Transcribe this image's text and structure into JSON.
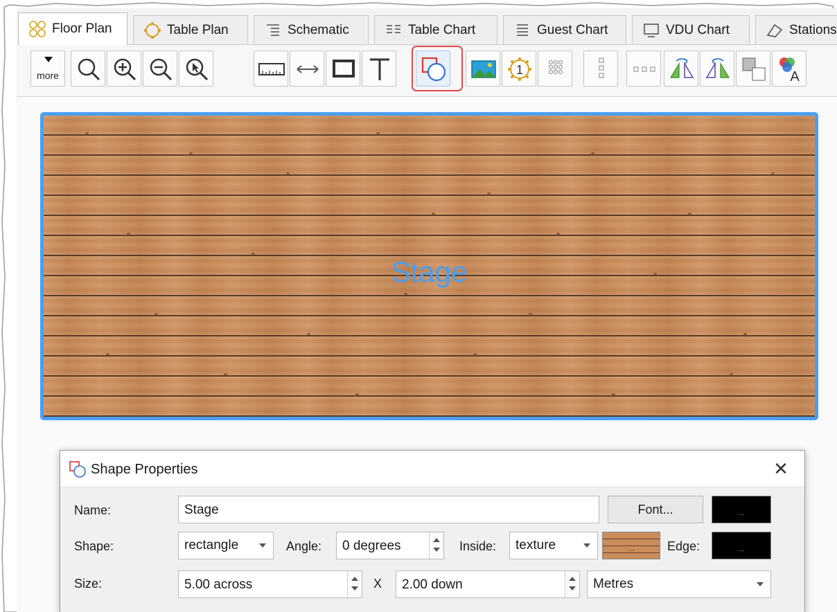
{
  "tabs": [
    {
      "label": "Floor Plan",
      "icon": "floor-plan-icon",
      "active": true
    },
    {
      "label": "Table Plan",
      "icon": "table-plan-icon",
      "active": false
    },
    {
      "label": "Schematic",
      "icon": "schematic-icon",
      "active": false
    },
    {
      "label": "Table Chart",
      "icon": "table-chart-icon",
      "active": false
    },
    {
      "label": "Guest Chart",
      "icon": "guest-chart-icon",
      "active": false
    },
    {
      "label": "VDU Chart",
      "icon": "vdu-chart-icon",
      "active": false
    },
    {
      "label": "Stations",
      "icon": "stations-icon",
      "active": false
    }
  ],
  "toolbar": {
    "more_label": "more",
    "tools": [
      "zoom-fit-icon",
      "zoom-in-icon",
      "zoom-out-icon",
      "zoom-select-icon",
      "ruler-icon",
      "measure-icon",
      "room-icon",
      "text-icon",
      "shape-icon",
      "image-icon",
      "number-icon",
      "grid-icon",
      "column-icon",
      "row-icon",
      "flip-horizontal-icon",
      "flip-vertical-icon",
      "arrange-icon",
      "color-font-icon"
    ],
    "selected_tool": "shape-icon"
  },
  "canvas": {
    "shape_label": "Stage",
    "label_color": "#4a9ff0",
    "selection_color": "#4a9ff0"
  },
  "dialog": {
    "title": "Shape Properties",
    "close_symbol": "✕",
    "name_label": "Name:",
    "name_value": "Stage",
    "font_button": "Font...",
    "font_color_swatch": "...",
    "shape_label": "Shape:",
    "shape_value": "rectangle",
    "angle_label": "Angle:",
    "angle_value": "0 degrees",
    "inside_label": "Inside:",
    "inside_value": "texture",
    "inside_swatch": "...",
    "edge_label": "Edge:",
    "edge_swatch": "...",
    "size_label": "Size:",
    "across_value": "5.00 across",
    "x_label": "X",
    "down_value": "2.00 down",
    "units_value": "Metres"
  },
  "colors": {
    "highlight": "#e0474c",
    "accent": "#4a9ff0",
    "font_color": "#000000",
    "edge_color": "#000000"
  }
}
